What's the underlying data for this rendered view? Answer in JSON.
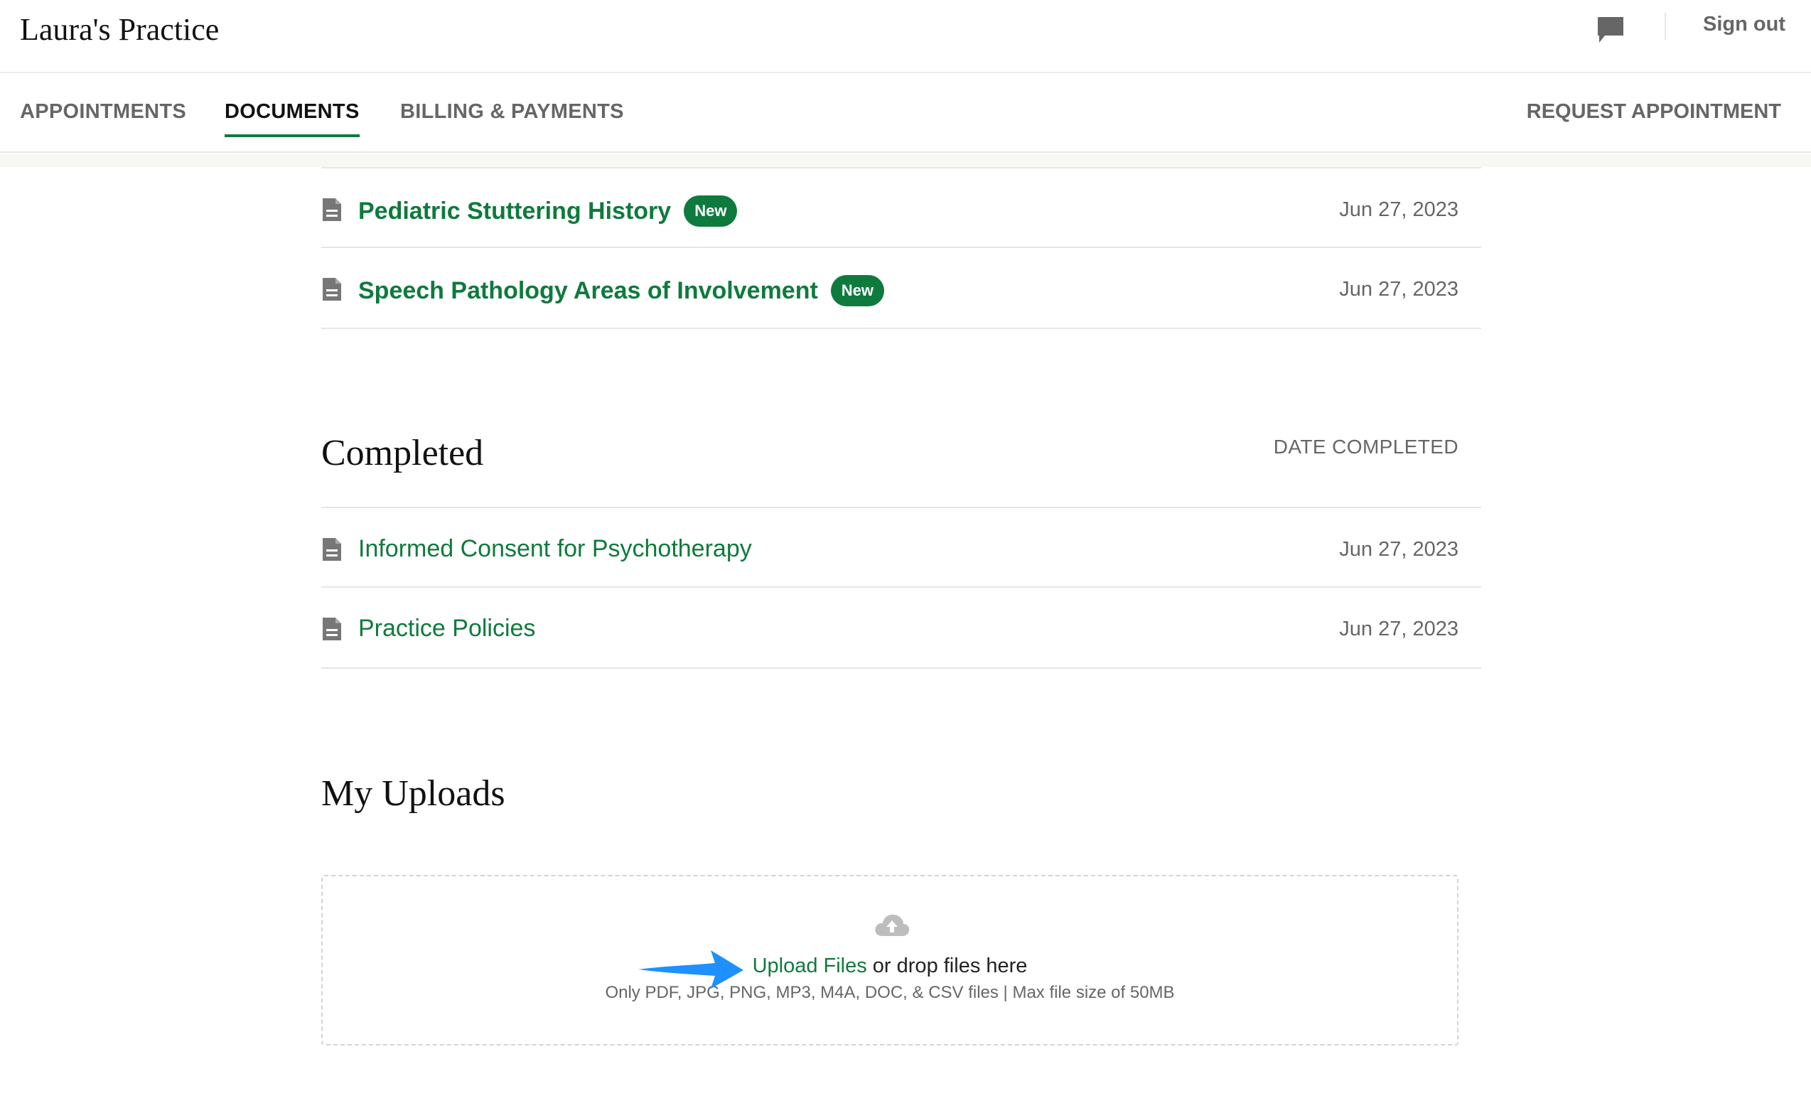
{
  "header": {
    "brand": "Laura's Practice",
    "chat_icon": "chat-bubble-icon",
    "sign_out": "Sign out"
  },
  "nav": {
    "tabs": [
      {
        "label": "APPOINTMENTS",
        "active": false
      },
      {
        "label": "DOCUMENTS",
        "active": true
      },
      {
        "label": "BILLING & PAYMENTS",
        "active": false
      }
    ],
    "request_appointment": "REQUEST APPOINTMENT"
  },
  "pending": {
    "items": [
      {
        "title": "Pediatric Stuttering History",
        "badge": "New",
        "date": "Jun 27, 2023"
      },
      {
        "title": "Speech Pathology Areas of Involvement",
        "badge": "New",
        "date": "Jun 27, 2023"
      }
    ]
  },
  "completed": {
    "title": "Completed",
    "column_label": "DATE COMPLETED",
    "items": [
      {
        "title": "Informed Consent for Psychotherapy",
        "date": "Jun 27, 2023"
      },
      {
        "title": "Practice Policies",
        "date": "Jun 27, 2023"
      }
    ]
  },
  "uploads": {
    "title": "My Uploads",
    "upload_link": "Upload Files",
    "drop_text": " or drop files here",
    "file_hint": "Only PDF, JPG, PNG, MP3, M4A, DOC, & CSV files | Max file size of 50MB",
    "cloud_icon": "cloud-upload-icon"
  },
  "colors": {
    "accent": "#0f7a3d",
    "muted_text": "#666666",
    "annotation_arrow": "#1e90ff"
  }
}
